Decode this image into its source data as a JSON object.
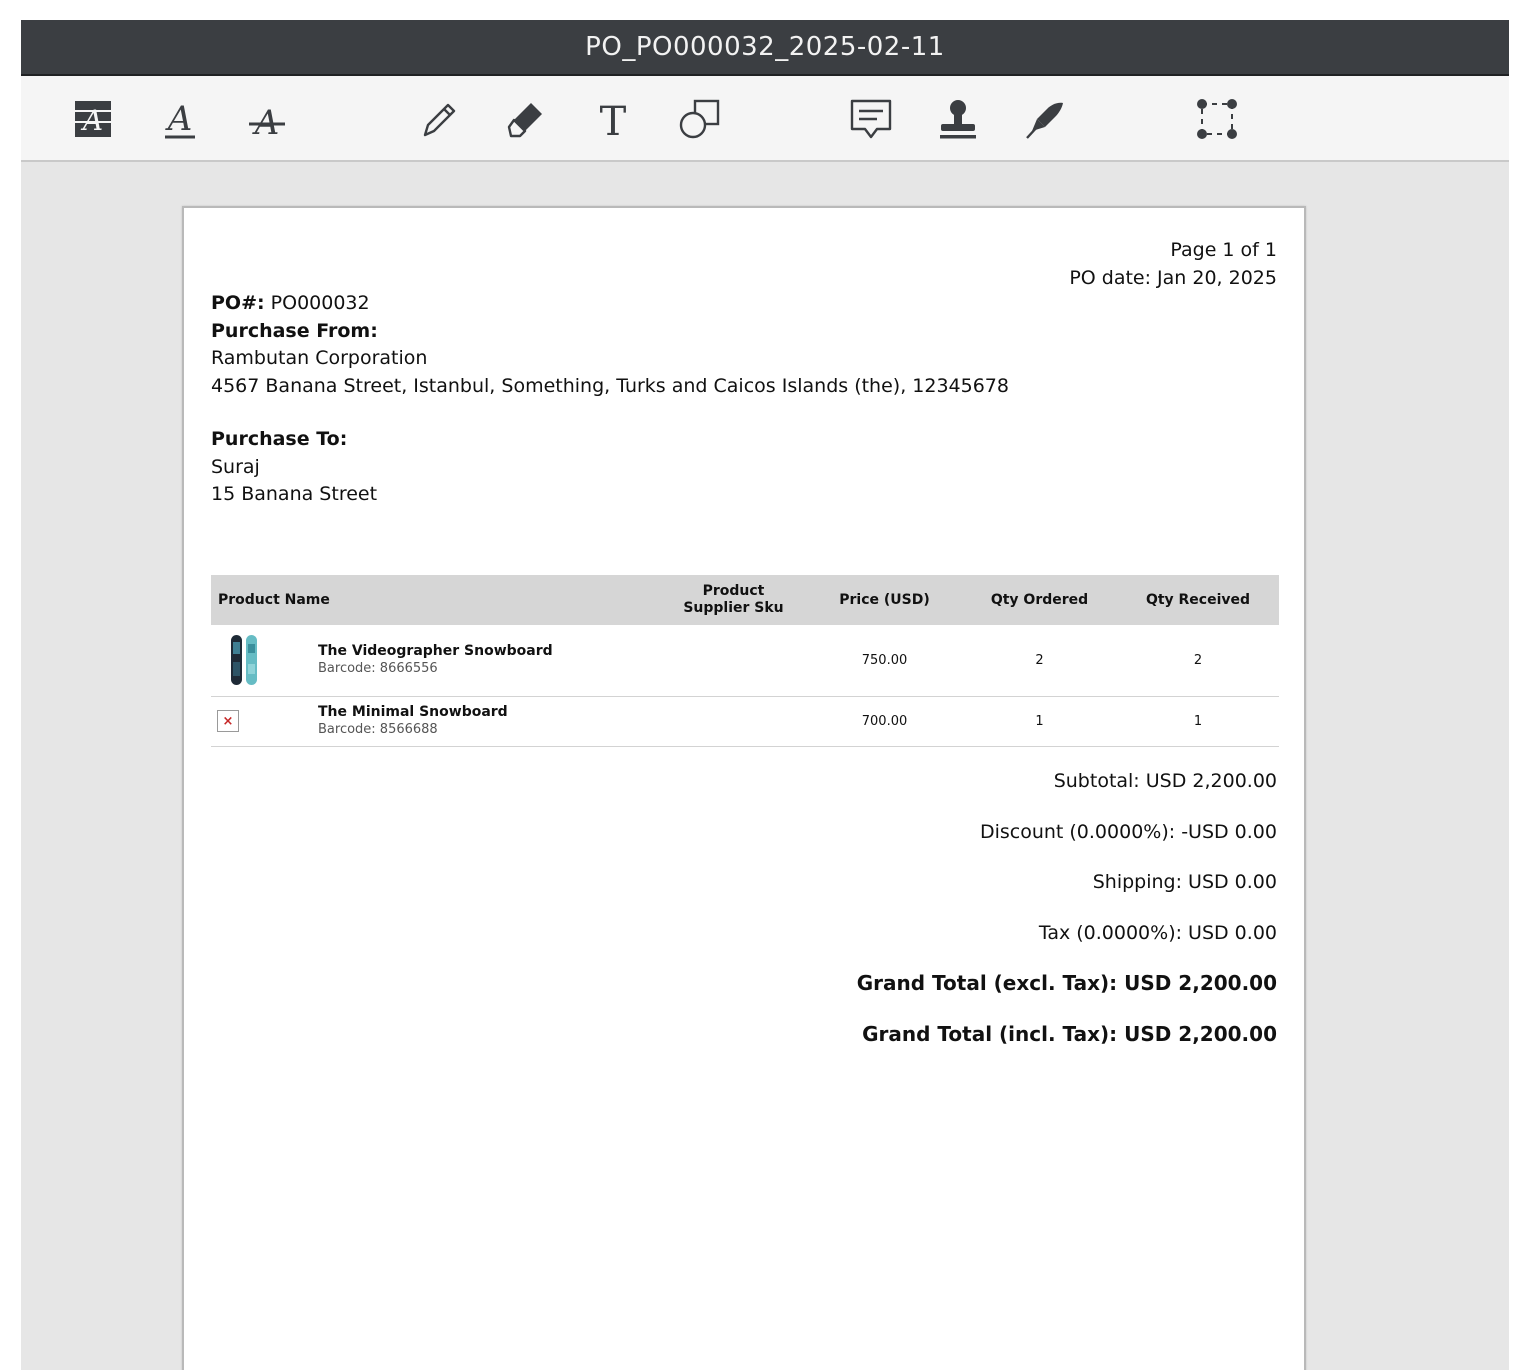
{
  "window": {
    "title": "PO_PO000032_2025-02-11"
  },
  "toolbar": {
    "tools": [
      {
        "name": "highlight-text-tool",
        "icon": "text-highlight-icon"
      },
      {
        "name": "underline-text-tool",
        "icon": "underline-icon"
      },
      {
        "name": "strikethrough-text-tool",
        "icon": "strikethrough-icon"
      },
      {
        "name": "pencil-tool",
        "icon": "pencil-icon"
      },
      {
        "name": "eraser-tool",
        "icon": "eraser-icon"
      },
      {
        "name": "text-tool",
        "icon": "text-icon"
      },
      {
        "name": "shapes-tool",
        "icon": "shapes-icon"
      },
      {
        "name": "note-tool",
        "icon": "comment-icon"
      },
      {
        "name": "stamp-tool",
        "icon": "stamp-icon"
      },
      {
        "name": "signature-tool",
        "icon": "pen-nib-icon"
      },
      {
        "name": "selection-tool",
        "icon": "selection-icon"
      }
    ]
  },
  "document": {
    "page_label": "Page 1 of 1",
    "po_date": "PO date: Jan 20, 2025",
    "po_number_label": "PO#:",
    "po_number": "PO000032",
    "purchase_from_label": "Purchase From:",
    "from_name": "Rambutan Corporation",
    "from_address": "4567 Banana Street, Istanbul, Something, Turks and Caicos Islands (the), 12345678",
    "purchase_to_label": "Purchase To:",
    "to_name": "Suraj",
    "to_address": "15 Banana Street",
    "table": {
      "headers": {
        "product_name": "Product Name",
        "supplier_sku": "Product Supplier Sku",
        "price": "Price (USD)",
        "qty_ordered": "Qty Ordered",
        "qty_received": "Qty Received"
      },
      "rows": [
        {
          "name": "The Videographer Snowboard",
          "barcode": "Barcode: 8666556",
          "sku": "",
          "price": "750.00",
          "qty_ordered": "2",
          "qty_received": "2",
          "image": "snowboard-thumbnail"
        },
        {
          "name": "The Minimal Snowboard",
          "barcode": "Barcode: 8566688",
          "sku": "",
          "price": "700.00",
          "qty_ordered": "1",
          "qty_received": "1",
          "image": "broken-image-icon"
        }
      ]
    },
    "totals": {
      "subtotal": "Subtotal: USD 2,200.00",
      "discount": "Discount (0.0000%): -USD 0.00",
      "shipping": "Shipping: USD 0.00",
      "tax": "Tax (0.0000%): USD 0.00",
      "grand_excl": "Grand Total (excl. Tax): USD 2,200.00",
      "grand_incl": "Grand Total (incl. Tax): USD 2,200.00"
    }
  }
}
